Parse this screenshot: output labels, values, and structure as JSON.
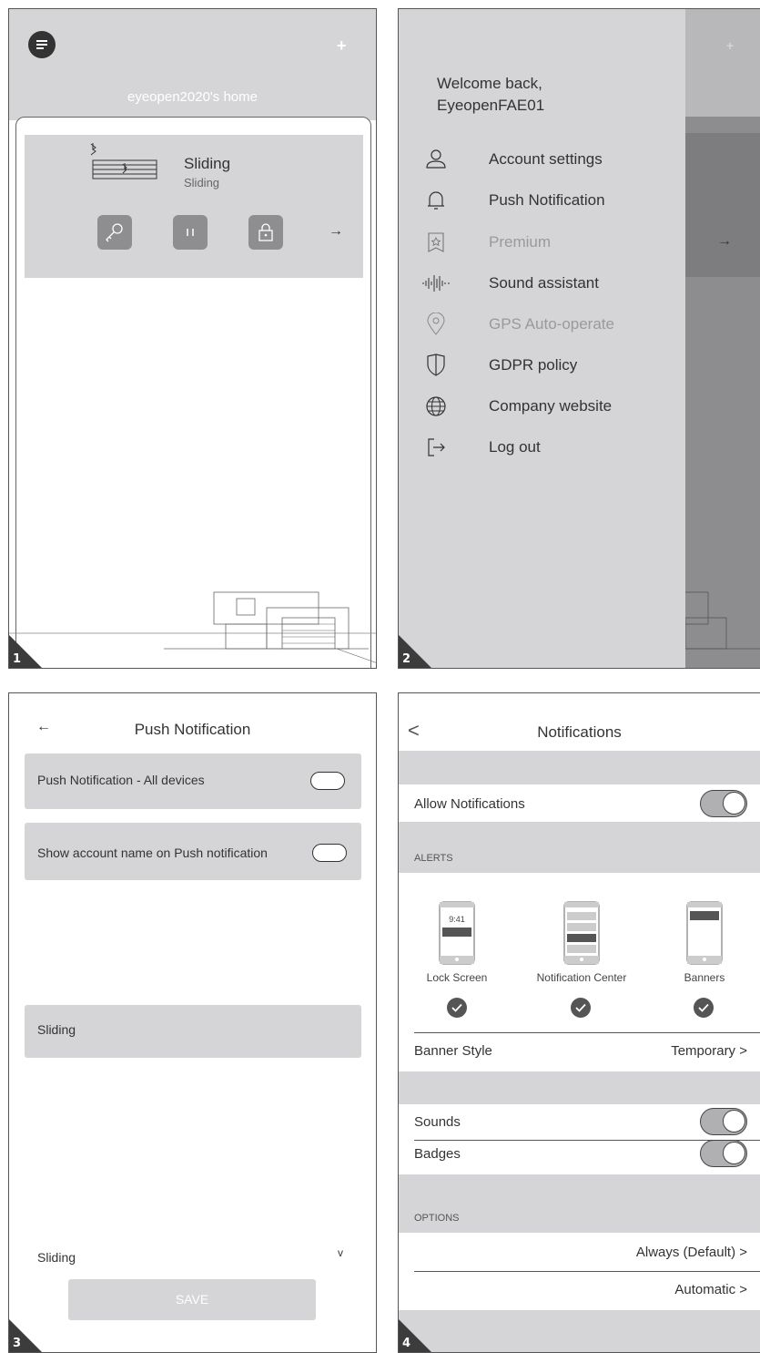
{
  "panel1": {
    "number": "1",
    "home_title": "eyeopen2020's home",
    "device": {
      "name": "Sliding",
      "subtitle": "Sliding"
    },
    "arrow": "→"
  },
  "panel2": {
    "number": "2",
    "welcome_line1": "Welcome back,",
    "welcome_line2": "EyeopenFAE01",
    "menu": [
      {
        "label": "Account settings",
        "icon": "person-icon"
      },
      {
        "label": "Push Notification",
        "icon": "bell-icon"
      },
      {
        "label": "Premium",
        "icon": "premium-badge-icon"
      },
      {
        "label": "Sound assistant",
        "icon": "sound-wave-icon"
      },
      {
        "label": "GPS Auto-operate",
        "icon": "location-pin-icon"
      },
      {
        "label": "GDPR policy",
        "icon": "shield-icon"
      },
      {
        "label": "Company website",
        "icon": "globe-icon"
      },
      {
        "label": "Log out",
        "icon": "logout-icon"
      }
    ],
    "bg_arrow": "→"
  },
  "panel3": {
    "number": "3",
    "back": "←",
    "title": "Push Notification",
    "row1": "Push Notification - All devices",
    "row2": "Show account name on Push notification",
    "section": "Sliding",
    "section_chevron": "v",
    "device_row": "Sliding",
    "save": "SAVE"
  },
  "panel4": {
    "number": "4",
    "back": "<",
    "title": "Notifications",
    "allow": "Allow Notifications",
    "alerts_header": "ALERTS",
    "lock_time": "9:41",
    "alerts": [
      "Lock Screen",
      "Notification Center",
      "Banners"
    ],
    "banner_style": "Banner Style",
    "banner_value": "Temporary >",
    "sounds": "Sounds",
    "badges": "Badges",
    "options_header": "OPTIONS",
    "option1": "Always (Default) >",
    "option2": "Automatic >"
  }
}
